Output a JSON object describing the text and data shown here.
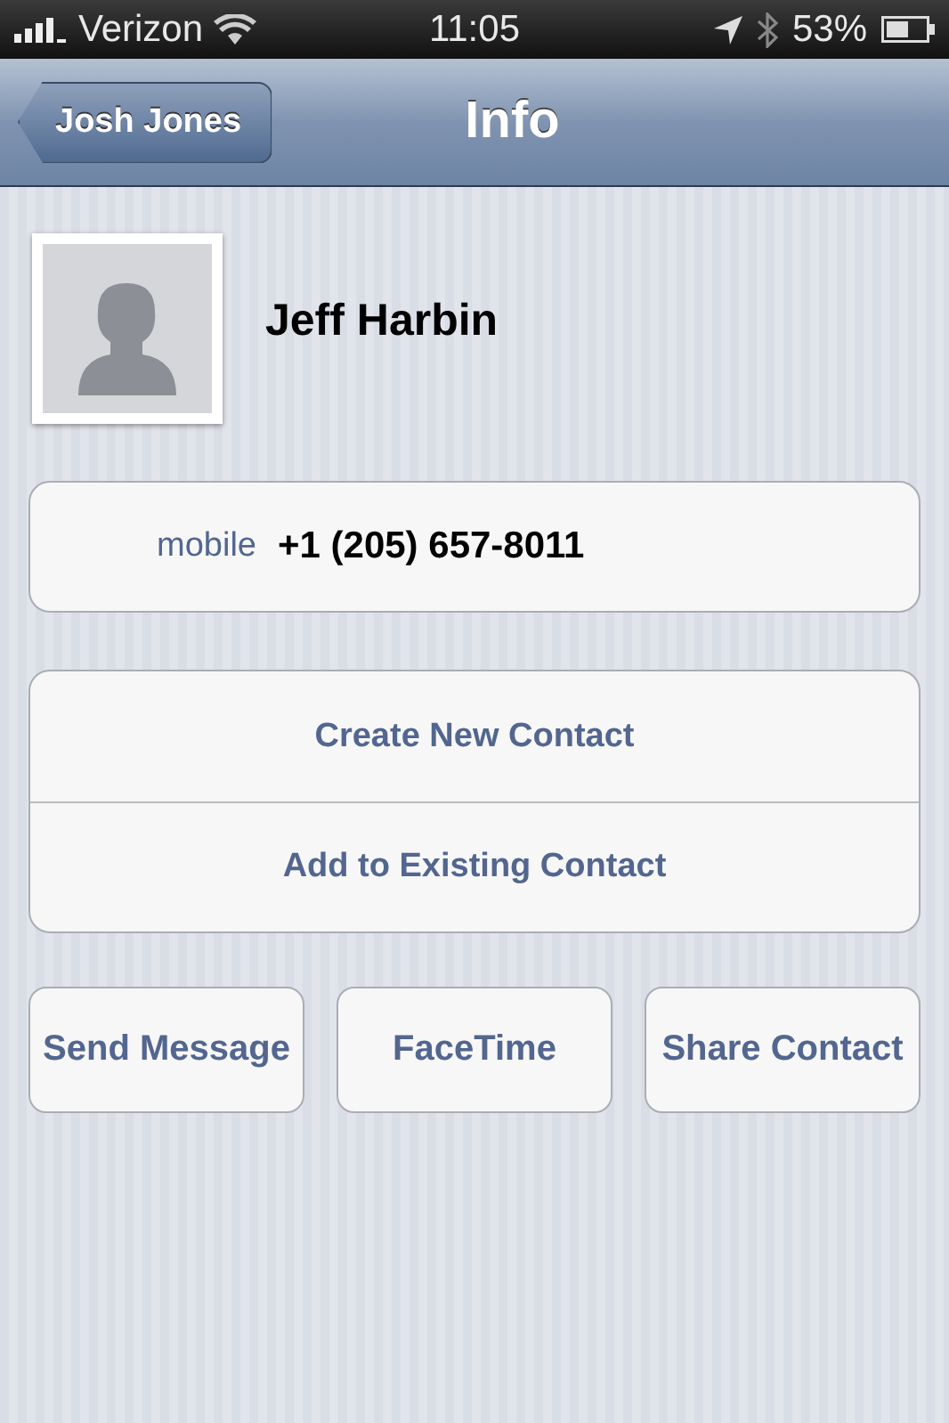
{
  "status_bar": {
    "carrier": "Verizon",
    "time": "11:05",
    "battery": "53%"
  },
  "nav_bar": {
    "back": "Josh Jones",
    "title": "Info"
  },
  "contact": {
    "name": "Jeff Harbin"
  },
  "phones": [
    {
      "label": "mobile",
      "value": "+1 (205) 657-8011"
    }
  ],
  "actions": [
    "Create New Contact",
    "Add to Existing Contact"
  ],
  "buttons": [
    {
      "label": "Send Message"
    },
    {
      "label": "FaceTime"
    },
    {
      "label": "Share Contact"
    }
  ]
}
